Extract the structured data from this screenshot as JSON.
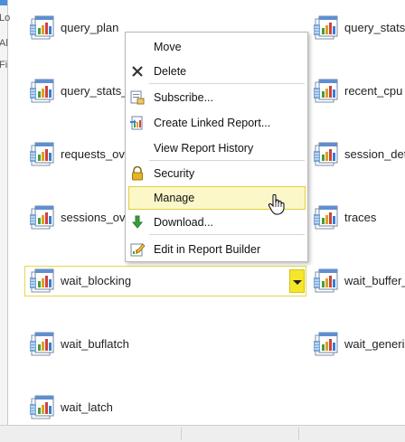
{
  "left_edge_snippets": [
    "Lo",
    "Al",
    "Fi"
  ],
  "reports": {
    "left": [
      {
        "name": "query_plan"
      },
      {
        "name": "query_stats_"
      },
      {
        "name": "requests_ov"
      },
      {
        "name": "sessions_ov"
      },
      {
        "name": "wait_blocking"
      },
      {
        "name": "wait_buflatch"
      },
      {
        "name": "wait_latch"
      }
    ],
    "right": [
      {
        "name": "query_stats"
      },
      {
        "name": "recent_cpu"
      },
      {
        "name": "session_det"
      },
      {
        "name": "traces"
      },
      {
        "name": "wait_buffer_"
      },
      {
        "name": "wait_generi"
      }
    ]
  },
  "selected_report": "wait_blocking",
  "context_menu": {
    "items": [
      {
        "label": "Move",
        "icon": "none"
      },
      {
        "label": "Delete",
        "icon": "delete-x-icon"
      },
      {
        "label": "Subscribe...",
        "icon": "subscribe-icon"
      },
      {
        "label": "Create Linked Report...",
        "icon": "linked-report-icon"
      },
      {
        "label": "View Report History",
        "icon": "none"
      },
      {
        "label": "Security",
        "icon": "lock-icon"
      },
      {
        "label": "Manage",
        "icon": "none",
        "highlighted": true
      },
      {
        "label": "Download...",
        "icon": "download-icon"
      },
      {
        "label": "Edit in Report Builder",
        "icon": "report-builder-icon"
      }
    ]
  },
  "colors": {
    "highlight_fill": "#fbf7c8",
    "highlight_border": "#e0cf3a",
    "dropdown_button": "#f5e62a"
  }
}
